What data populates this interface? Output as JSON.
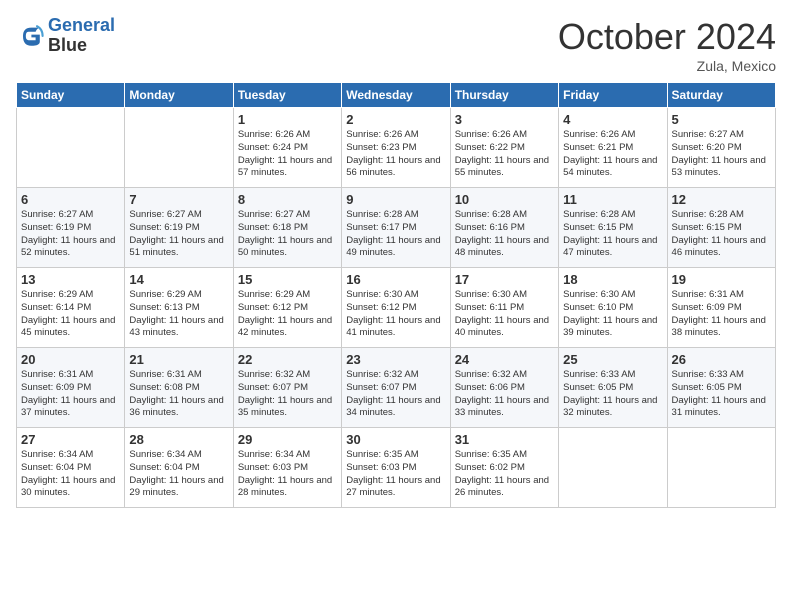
{
  "header": {
    "logo_line1": "General",
    "logo_line2": "Blue",
    "month": "October 2024",
    "location": "Zula, Mexico"
  },
  "weekdays": [
    "Sunday",
    "Monday",
    "Tuesday",
    "Wednesday",
    "Thursday",
    "Friday",
    "Saturday"
  ],
  "weeks": [
    [
      {
        "day": "",
        "text": ""
      },
      {
        "day": "",
        "text": ""
      },
      {
        "day": "1",
        "text": "Sunrise: 6:26 AM\nSunset: 6:24 PM\nDaylight: 11 hours and 57 minutes."
      },
      {
        "day": "2",
        "text": "Sunrise: 6:26 AM\nSunset: 6:23 PM\nDaylight: 11 hours and 56 minutes."
      },
      {
        "day": "3",
        "text": "Sunrise: 6:26 AM\nSunset: 6:22 PM\nDaylight: 11 hours and 55 minutes."
      },
      {
        "day": "4",
        "text": "Sunrise: 6:26 AM\nSunset: 6:21 PM\nDaylight: 11 hours and 54 minutes."
      },
      {
        "day": "5",
        "text": "Sunrise: 6:27 AM\nSunset: 6:20 PM\nDaylight: 11 hours and 53 minutes."
      }
    ],
    [
      {
        "day": "6",
        "text": "Sunrise: 6:27 AM\nSunset: 6:19 PM\nDaylight: 11 hours and 52 minutes."
      },
      {
        "day": "7",
        "text": "Sunrise: 6:27 AM\nSunset: 6:19 PM\nDaylight: 11 hours and 51 minutes."
      },
      {
        "day": "8",
        "text": "Sunrise: 6:27 AM\nSunset: 6:18 PM\nDaylight: 11 hours and 50 minutes."
      },
      {
        "day": "9",
        "text": "Sunrise: 6:28 AM\nSunset: 6:17 PM\nDaylight: 11 hours and 49 minutes."
      },
      {
        "day": "10",
        "text": "Sunrise: 6:28 AM\nSunset: 6:16 PM\nDaylight: 11 hours and 48 minutes."
      },
      {
        "day": "11",
        "text": "Sunrise: 6:28 AM\nSunset: 6:15 PM\nDaylight: 11 hours and 47 minutes."
      },
      {
        "day": "12",
        "text": "Sunrise: 6:28 AM\nSunset: 6:15 PM\nDaylight: 11 hours and 46 minutes."
      }
    ],
    [
      {
        "day": "13",
        "text": "Sunrise: 6:29 AM\nSunset: 6:14 PM\nDaylight: 11 hours and 45 minutes."
      },
      {
        "day": "14",
        "text": "Sunrise: 6:29 AM\nSunset: 6:13 PM\nDaylight: 11 hours and 43 minutes."
      },
      {
        "day": "15",
        "text": "Sunrise: 6:29 AM\nSunset: 6:12 PM\nDaylight: 11 hours and 42 minutes."
      },
      {
        "day": "16",
        "text": "Sunrise: 6:30 AM\nSunset: 6:12 PM\nDaylight: 11 hours and 41 minutes."
      },
      {
        "day": "17",
        "text": "Sunrise: 6:30 AM\nSunset: 6:11 PM\nDaylight: 11 hours and 40 minutes."
      },
      {
        "day": "18",
        "text": "Sunrise: 6:30 AM\nSunset: 6:10 PM\nDaylight: 11 hours and 39 minutes."
      },
      {
        "day": "19",
        "text": "Sunrise: 6:31 AM\nSunset: 6:09 PM\nDaylight: 11 hours and 38 minutes."
      }
    ],
    [
      {
        "day": "20",
        "text": "Sunrise: 6:31 AM\nSunset: 6:09 PM\nDaylight: 11 hours and 37 minutes."
      },
      {
        "day": "21",
        "text": "Sunrise: 6:31 AM\nSunset: 6:08 PM\nDaylight: 11 hours and 36 minutes."
      },
      {
        "day": "22",
        "text": "Sunrise: 6:32 AM\nSunset: 6:07 PM\nDaylight: 11 hours and 35 minutes."
      },
      {
        "day": "23",
        "text": "Sunrise: 6:32 AM\nSunset: 6:07 PM\nDaylight: 11 hours and 34 minutes."
      },
      {
        "day": "24",
        "text": "Sunrise: 6:32 AM\nSunset: 6:06 PM\nDaylight: 11 hours and 33 minutes."
      },
      {
        "day": "25",
        "text": "Sunrise: 6:33 AM\nSunset: 6:05 PM\nDaylight: 11 hours and 32 minutes."
      },
      {
        "day": "26",
        "text": "Sunrise: 6:33 AM\nSunset: 6:05 PM\nDaylight: 11 hours and 31 minutes."
      }
    ],
    [
      {
        "day": "27",
        "text": "Sunrise: 6:34 AM\nSunset: 6:04 PM\nDaylight: 11 hours and 30 minutes."
      },
      {
        "day": "28",
        "text": "Sunrise: 6:34 AM\nSunset: 6:04 PM\nDaylight: 11 hours and 29 minutes."
      },
      {
        "day": "29",
        "text": "Sunrise: 6:34 AM\nSunset: 6:03 PM\nDaylight: 11 hours and 28 minutes."
      },
      {
        "day": "30",
        "text": "Sunrise: 6:35 AM\nSunset: 6:03 PM\nDaylight: 11 hours and 27 minutes."
      },
      {
        "day": "31",
        "text": "Sunrise: 6:35 AM\nSunset: 6:02 PM\nDaylight: 11 hours and 26 minutes."
      },
      {
        "day": "",
        "text": ""
      },
      {
        "day": "",
        "text": ""
      }
    ]
  ]
}
